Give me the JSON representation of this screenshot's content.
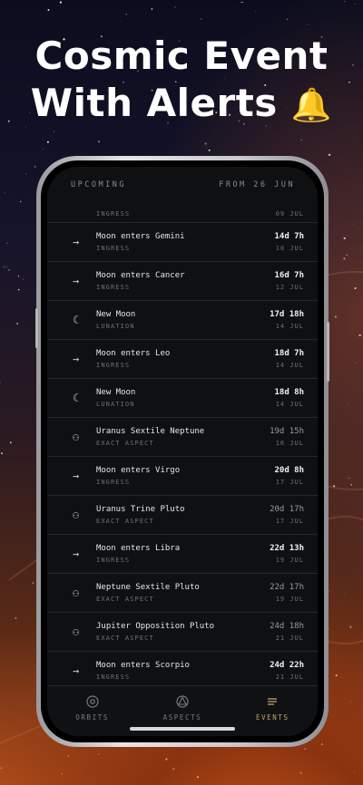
{
  "headline": {
    "line1": "Cosmic Event",
    "line2": "With Alerts",
    "bell_icon": "🔔"
  },
  "header": {
    "left": "UPCOMING",
    "right": "FROM 26 JUN"
  },
  "partial_row": {
    "type": "INGRESS",
    "date": "09 JUL"
  },
  "events": [
    {
      "icon": "arrow-right-icon",
      "glyph": "→",
      "name": "Moon enters Gemini",
      "type": "INGRESS",
      "countdown": "14d 7h",
      "date": "10 JUL",
      "dim": false
    },
    {
      "icon": "arrow-right-icon",
      "glyph": "→",
      "name": "Moon enters Cancer",
      "type": "INGRESS",
      "countdown": "16d 7h",
      "date": "12 JUL",
      "dim": false
    },
    {
      "icon": "moon-icon",
      "glyph": "☾",
      "name": "New Moon",
      "type": "LUNATION",
      "countdown": "17d 18h",
      "date": "14 JUL",
      "dim": false
    },
    {
      "icon": "arrow-right-icon",
      "glyph": "→",
      "name": "Moon enters Leo",
      "type": "INGRESS",
      "countdown": "18d 7h",
      "date": "14 JUL",
      "dim": false
    },
    {
      "icon": "moon-icon",
      "glyph": "☾",
      "name": "New Moon",
      "type": "LUNATION",
      "countdown": "18d 8h",
      "date": "14 JUL",
      "dim": false
    },
    {
      "icon": "aspect-icon",
      "glyph": "⚇",
      "name": "Uranus Sextile Neptune",
      "type": "EXACT ASPECT",
      "countdown": "19d 15h",
      "date": "16 JUL",
      "dim": true
    },
    {
      "icon": "arrow-right-icon",
      "glyph": "→",
      "name": "Moon enters Virgo",
      "type": "INGRESS",
      "countdown": "20d 8h",
      "date": "17 JUL",
      "dim": false
    },
    {
      "icon": "aspect-icon",
      "glyph": "⚇",
      "name": "Uranus Trine Pluto",
      "type": "EXACT ASPECT",
      "countdown": "20d 17h",
      "date": "17 JUL",
      "dim": true
    },
    {
      "icon": "arrow-right-icon",
      "glyph": "→",
      "name": "Moon enters Libra",
      "type": "INGRESS",
      "countdown": "22d 13h",
      "date": "19 JUL",
      "dim": false
    },
    {
      "icon": "aspect-icon",
      "glyph": "⚇",
      "name": "Neptune Sextile Pluto",
      "type": "EXACT ASPECT",
      "countdown": "22d 17h",
      "date": "19 JUL",
      "dim": true
    },
    {
      "icon": "aspect-icon",
      "glyph": "⚇",
      "name": "Jupiter Opposition Pluto",
      "type": "EXACT ASPECT",
      "countdown": "24d 18h",
      "date": "21 JUL",
      "dim": true
    },
    {
      "icon": "arrow-right-icon",
      "glyph": "→",
      "name": "Moon enters Scorpio",
      "type": "INGRESS",
      "countdown": "24d 22h",
      "date": "21 JUL",
      "dim": false
    }
  ],
  "tabs": [
    {
      "icon": "orbits-icon",
      "label": "ORBITS",
      "active": false
    },
    {
      "icon": "aspects-icon",
      "label": "ASPECTS",
      "active": false
    },
    {
      "icon": "events-icon",
      "label": "EVENTS",
      "active": true
    }
  ],
  "colors": {
    "accent": "#c9a46a",
    "bell": "#f0a020",
    "screen_bg": "#0f1012"
  }
}
